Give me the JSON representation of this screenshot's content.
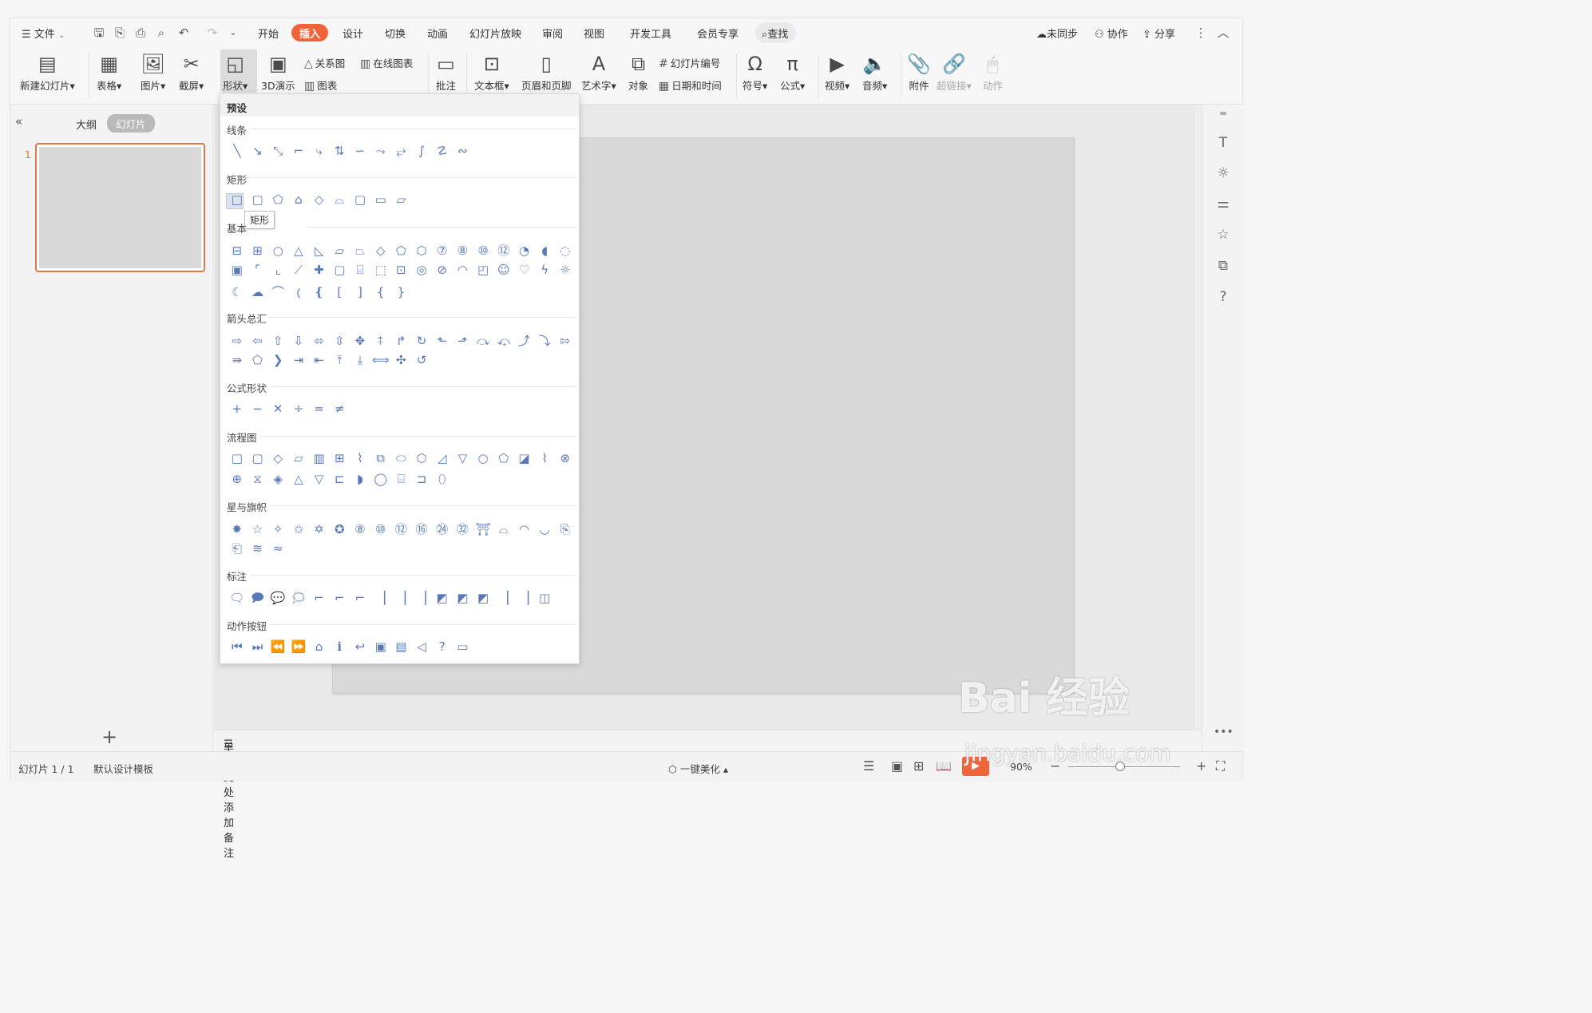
{
  "menubar": {
    "file": "文件",
    "tabs": [
      "开始",
      "插入",
      "设计",
      "切换",
      "动画",
      "幻灯片放映",
      "审阅",
      "视图",
      "开发工具",
      "会员专享"
    ],
    "active_tab": "插入",
    "search": "查找",
    "sync": "未同步",
    "collab": "协作",
    "share": "分享"
  },
  "ribbon": {
    "new_slide": "新建幻灯片",
    "table": "表格",
    "image": "图片",
    "screenshot": "截屏",
    "shape": "形状",
    "demo3d": "3D演示",
    "relation": "关系图",
    "online_chart": "在线图表",
    "chart": "图表",
    "comment": "批注",
    "textbox": "文本框",
    "header_footer": "页眉和页脚",
    "wordart": "艺术字",
    "object": "对象",
    "slide_number": "幻灯片编号",
    "datetime": "日期和时间",
    "symbol": "符号",
    "formula": "公式",
    "video": "视频",
    "audio": "音频",
    "attachment": "附件",
    "hyperlink": "超链接",
    "action": "动作"
  },
  "leftpanel": {
    "outline": "大纲",
    "slides": "幻灯片",
    "slide_number": "1"
  },
  "notes": {
    "placeholder": "单击此处添加备注"
  },
  "statusbar": {
    "slide_info": "幻灯片 1 / 1",
    "template": "默认设计模板",
    "beautify": "一键美化",
    "zoom": "90%"
  },
  "dropdown": {
    "header": "预设",
    "sections": {
      "lines": "线条",
      "rect": "矩形",
      "basic": "基本",
      "arrows": "箭头总汇",
      "formula": "公式形状",
      "flow": "流程图",
      "stars": "星与旗帜",
      "callouts": "标注",
      "actions": "动作按钮"
    },
    "tooltip": "矩形"
  },
  "watermark": {
    "line1": "Bai 经验",
    "line2": "jingyan.baidu.com"
  }
}
